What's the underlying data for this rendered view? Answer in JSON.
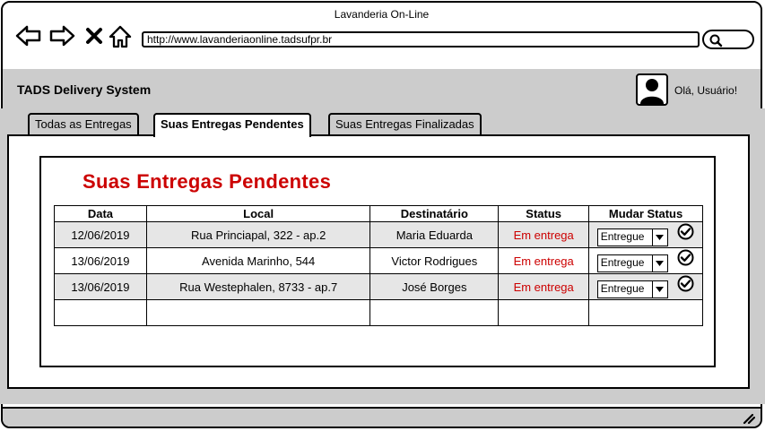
{
  "window": {
    "title": "Lavanderia On-Line"
  },
  "browser": {
    "url": "http://www.lavanderiaonline.tadsufpr.br"
  },
  "app": {
    "name": "TADS Delivery System",
    "greeting": "Olá, Usuário!"
  },
  "tabs": [
    {
      "label": "Todas as Entregas",
      "active": false
    },
    {
      "label": "Suas Entregas Pendentes",
      "active": true
    },
    {
      "label": "Suas Entregas Finalizadas",
      "active": false
    }
  ],
  "section": {
    "title": "Suas Entregas Pendentes"
  },
  "table": {
    "headers": [
      "Data",
      "Local",
      "Destinatário",
      "Status",
      "Mudar Status"
    ],
    "rows": [
      {
        "data": "12/06/2019",
        "local": "Rua Princiapal, 322 - ap.2",
        "destinatario": "Maria Eduarda",
        "status": "Em entrega",
        "select": "Entregue"
      },
      {
        "data": "13/06/2019",
        "local": "Avenida Marinho, 544",
        "destinatario": "Victor Rodrigues",
        "status": "Em entrega",
        "select": "Entregue"
      },
      {
        "data": "13/06/2019",
        "local": "Rua Westephalen, 8733 - ap.7",
        "destinatario": "José Borges",
        "status": "Em entrega",
        "select": "Entregue"
      }
    ]
  },
  "colors": {
    "accent_red": "#cc0000",
    "chrome_gray": "#cccccc",
    "row_alt": "#e6e6e6"
  }
}
